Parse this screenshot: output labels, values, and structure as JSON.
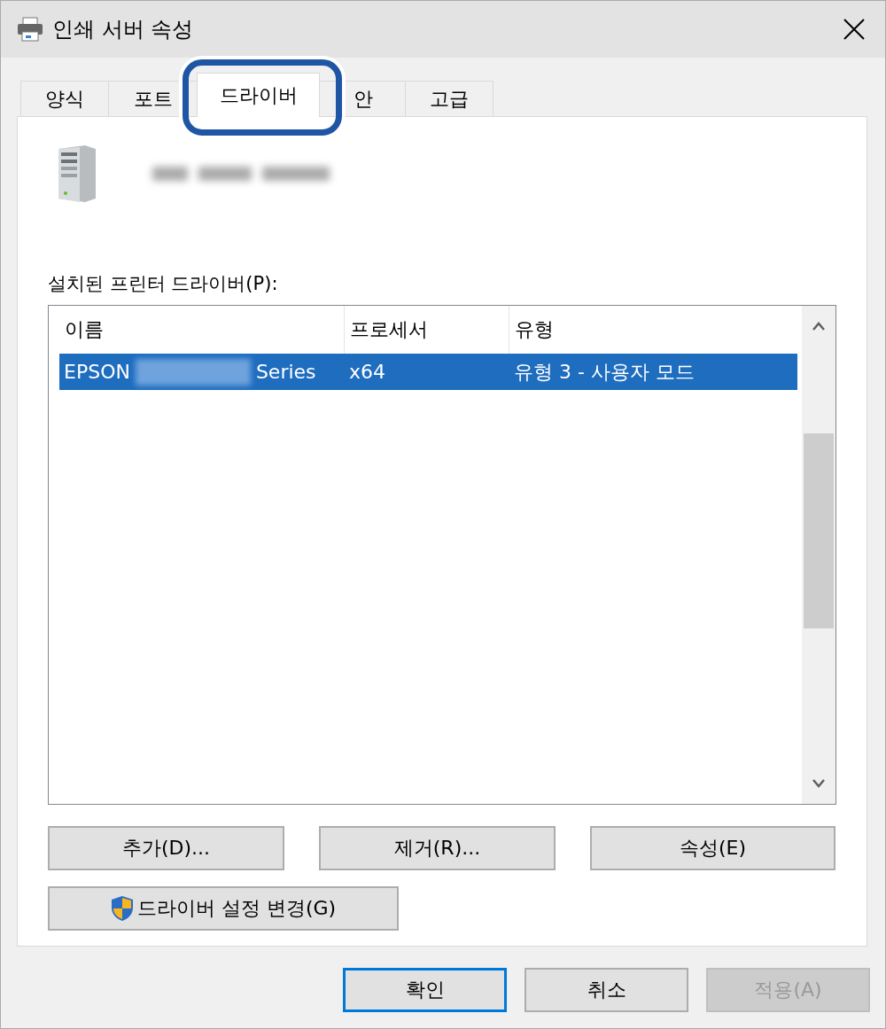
{
  "window": {
    "title": "인쇄 서버 속성"
  },
  "tabs": [
    {
      "label": "양식",
      "selected": false
    },
    {
      "label": "포트",
      "selected": false
    },
    {
      "label": "드라이버",
      "selected": true
    },
    {
      "label": "안",
      "selected": false
    },
    {
      "label": "고급",
      "selected": false
    }
  ],
  "drivers_label": "설치된 프린터 드라이버(P):",
  "table": {
    "columns": [
      "이름",
      "프로세서",
      "유형"
    ],
    "rows": [
      {
        "name_start": "EPSON",
        "name_end": "Series",
        "processor": "x64",
        "type": "유형 3 - 사용자 모드",
        "selected": true
      }
    ]
  },
  "buttons": [
    {
      "label": "추가(D)...",
      "kind": "plain"
    },
    {
      "label": "제거(R)...",
      "kind": "plain"
    },
    {
      "label": "속성(E)",
      "kind": "plain"
    },
    {
      "label": "드라이버 설정 변경(G)",
      "kind": "shield"
    }
  ],
  "dialog_buttons": [
    {
      "label": "확인",
      "default": true,
      "disabled": false
    },
    {
      "label": "취소",
      "default": false,
      "disabled": false
    },
    {
      "label": "적용(A)",
      "default": false,
      "disabled": true
    }
  ]
}
